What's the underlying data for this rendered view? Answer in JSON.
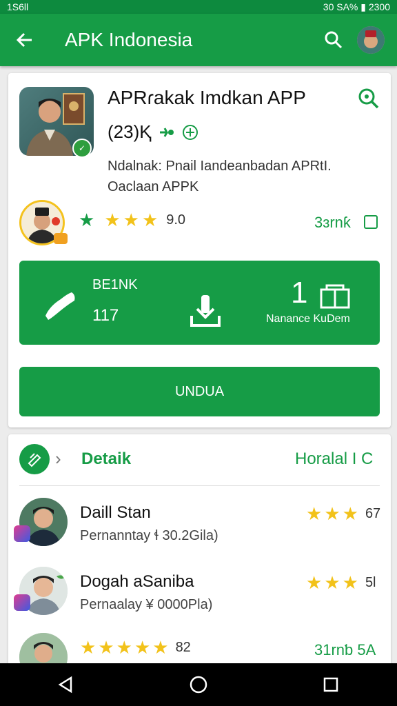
{
  "status_bar": {
    "left": "1S6ll",
    "right": "30 SA% ▮ 2300"
  },
  "app_bar": {
    "title": "APK Indonesia",
    "back_icon": "arrow-left-icon",
    "search_icon": "search-icon"
  },
  "app": {
    "title": "APRɾakak Imdkan APP",
    "subtitle": "(23)Ⱪ",
    "description": "Ndalnak: Pnail Iandeanbadan APRtI. Oaclaan APPK",
    "rating_value": "9.0",
    "size": "3ɜrnƙ",
    "rating_stars": 4
  },
  "stats": {
    "label": "BE1NK",
    "number": "117",
    "big_number": "1",
    "caption": "Nanance KuDem"
  },
  "download_button": "UNDUA",
  "detail": {
    "title": "Detaik",
    "right": "Horalal I C"
  },
  "reviews": [
    {
      "name": "Daill Stan",
      "meta": "Pernanntay ɬ 30.2Gila)",
      "score": "67",
      "stars": 3
    },
    {
      "name": "Dogah aSaniba",
      "meta": "Pernaalay ¥ 0000Pla)",
      "score": "5l",
      "stars": 3
    }
  ],
  "review3": {
    "score": "82",
    "stars": 5,
    "right": "31rnƅ 5A"
  },
  "colors": {
    "primary": "#169c46",
    "status": "#0d8a3e",
    "star": "#f2c21a"
  }
}
